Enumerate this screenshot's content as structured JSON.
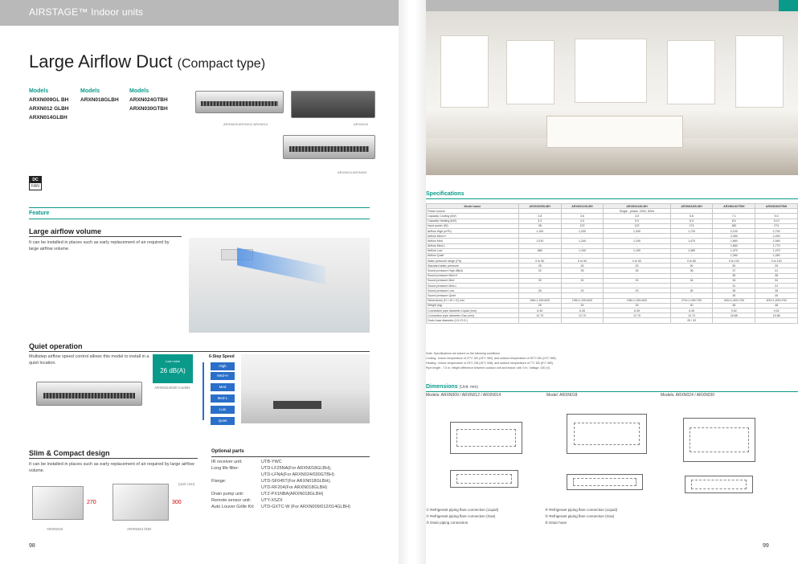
{
  "left": {
    "series_brand": "AIRSTAGE",
    "series_sub": "™ Indoor units",
    "title_main": "Large Airflow Duct",
    "title_paren": "(Compact type)",
    "models": [
      {
        "heading": "Models",
        "items": [
          "ARXN009GL BH",
          "ARXN012 GLBH",
          "ARXN014GLBH"
        ]
      },
      {
        "heading": "Models",
        "items": [
          "ARXN018GLBH"
        ]
      },
      {
        "heading": "Models",
        "items": [
          "ARXN024GTBH",
          "ARXN030GTBH"
        ]
      }
    ],
    "captions": {
      "unit1": "ARXN009 ARXN012 ARXN014",
      "unit2": "ARXN018",
      "unit3": "ARXN024 ARXN030"
    },
    "dcfan": {
      "top": "DC",
      "bottom": "FAN"
    },
    "feature_head": "Feature",
    "feat1_title": "Large airflow volume",
    "feat1_text": "It can be installed in places such as early replacement of air required by large airflow volume.",
    "feat2_title": "Quiet operation",
    "feat2_text": "Multistep airflow speed control allows this model to install in a quiet location.",
    "quiet_badge": {
      "label": "Low noise",
      "value": "26 dB(A)"
    },
    "quiet_model": "ARXN024/030 models",
    "step_title": "6-Step Speed",
    "steps": [
      "High",
      "Med-H",
      "Med",
      "Med-L",
      "Low",
      "Quiet"
    ],
    "feat3_title": "Slim & Compact design",
    "feat3_text": "It can be installed in places such as early replacement of air required by large airflow volume.",
    "unit_note": "(unit: mm)",
    "box1": {
      "height": "270",
      "caption": "ARXN018"
    },
    "box2": {
      "height": "300",
      "caption": "ARXN024 /030"
    },
    "optional_title": "Optional parts",
    "optional": [
      {
        "k": "IR receiver unit:",
        "v": "UTB-YWC"
      },
      {
        "k": "Long life filter:",
        "v": "UTD-LF25NA(For ARXN018GLBH),"
      },
      {
        "k": "",
        "v": "UTD-LFNA(For ARXN024/030GTBH)"
      },
      {
        "k": "Flange:",
        "v": "UTD-SF045T(For ARXN018GLBH),"
      },
      {
        "k": "",
        "v": "UTD-RF204(For ARXN018GLBH)"
      },
      {
        "k": "Drain pump unit:",
        "v": "UTZ-PX1NBA(ARXN018GLBH)"
      },
      {
        "k": "Remote sensor unit:",
        "v": "UTY-XSZX"
      },
      {
        "k": "Auto Louver Grille Kit:",
        "v": "UTD-GXTC-W (For ARXN009/012/014GLBH)"
      }
    ],
    "page_number": "98"
  },
  "right": {
    "spec_head": "Specifications",
    "spec_columns": [
      "Model name",
      "ARXN009GLBH",
      "ARXN012GLBH",
      "ARXN014GLBH",
      "ARXN018GLBH",
      "ARXN024GTBH",
      "ARXN030GTBH"
    ],
    "spec_rows": [
      [
        "Power source",
        "",
        "",
        "Single - phase, 230V, 50Hz",
        "",
        "",
        ""
      ],
      [
        "Capacity Cooling (kW)",
        "2.8",
        "3.6",
        "4.5",
        "5.6",
        "7.1",
        "9.0"
      ],
      [
        "Capacity Heating (kW)",
        "3.2",
        "4.0",
        "5.0",
        "6.3",
        "8.0",
        "10.0"
      ],
      [
        "Input power (W)",
        "38",
        "122",
        "122",
        "174",
        "180",
        "274"
      ],
      [
        "Airflow High (m³/h)",
        "1,100",
        "1,330",
        "1,330",
        "1,720",
        "2,100",
        "2,700"
      ],
      [
        "Airflow Med-H",
        "-",
        "-",
        "-",
        "-",
        "2,050",
        "2,490"
      ],
      [
        "Airflow Med",
        "1,010",
        "1,240",
        "1,240",
        "1,470",
        "1,860",
        "2,060"
      ],
      [
        "Airflow Med-L",
        "-",
        "-",
        "-",
        "-",
        "1,660",
        "1,770"
      ],
      [
        "Airflow Low",
        "880",
        "1,100",
        "1,100",
        "1,380",
        "1,470",
        "1,470"
      ],
      [
        "Airflow Quiet",
        "-",
        "-",
        "-",
        "-",
        "1,260",
        "1,260"
      ],
      [
        "Static pressure range (Pa)",
        "0 to 50",
        "0 to 50",
        "0 to 50",
        "0 to 80",
        "0 to 100",
        "0 to 100"
      ],
      [
        "Standard static pressure",
        "25",
        "25",
        "25",
        "50",
        "50",
        "25"
      ],
      [
        "Sound pressure High dB(A)",
        "32",
        "35",
        "35",
        "36",
        "37",
        "41"
      ],
      [
        "Sound pressure Med-H",
        "-",
        "-",
        "-",
        "-",
        "35",
        "38"
      ],
      [
        "Sound pressure Med",
        "30",
        "32",
        "32",
        "34",
        "34",
        "34"
      ],
      [
        "Sound pressure Med-L",
        "-",
        "-",
        "-",
        "-",
        "31",
        "31"
      ],
      [
        "Sound pressure Low",
        "28",
        "29",
        "29",
        "30",
        "28",
        "28"
      ],
      [
        "Sound pressure Quiet",
        "-",
        "-",
        "-",
        "-",
        "26",
        "26"
      ],
      [
        "Dimensions (H × W × D) mm",
        "198×1,100×620",
        "198×1,100×620",
        "198×1,100×620",
        "270×1,135×700",
        "400×1,400×700",
        "400×1,400×700"
      ],
      [
        "Weight (kg)",
        "26",
        "26",
        "26",
        "40",
        "48",
        "48"
      ],
      [
        "Connection pipe diameter Liquid (mm)",
        "6.35",
        "6.35",
        "6.35",
        "6.35",
        "9.52",
        "9.52"
      ],
      [
        "Connection pipe diameter Gas (mm)",
        "12.70",
        "12.70",
        "12.70",
        "12.70",
        "15.88",
        "15.88"
      ],
      [
        "Drain hose diameter (I.D./O.D.)",
        "",
        "",
        "",
        "25 / 32",
        "",
        ""
      ]
    ],
    "notes": [
      "Note: Specifications are based on the following conditions.",
      "Cooling : Indoor temperature of 27°C DB (19°C WB), and outdoor temperature of 35°C DB (24°C WB).",
      "Heating : Indoor temperature of 20°C DB (15°C WB), and outdoor temperature of 7°C DB (6°C WB).",
      "Pipe length : 7.5 m, Height difference between outdoor unit and indoor unit: 0 m, Voltage: 230 (V)."
    ],
    "dim_head": "Dimensions",
    "dim_unit": "(Unit: mm)",
    "dim_labels": [
      "Models: ARXN009 / ARXN012 / ARXN014",
      "Model: ARXN018",
      "Models: ARXN024 / ARXN030"
    ],
    "legend": [
      "① Refrigerant piping flare connection (Liquid)",
      "② Refrigerant piping flare connection (Gas)",
      "③ Drain piping connection",
      "④ Refrigerant piping flare connection (Liquid)",
      "⑤ Refrigerant piping flare connection (Gas)",
      "⑥ Drain hose"
    ],
    "page_number": "99"
  }
}
